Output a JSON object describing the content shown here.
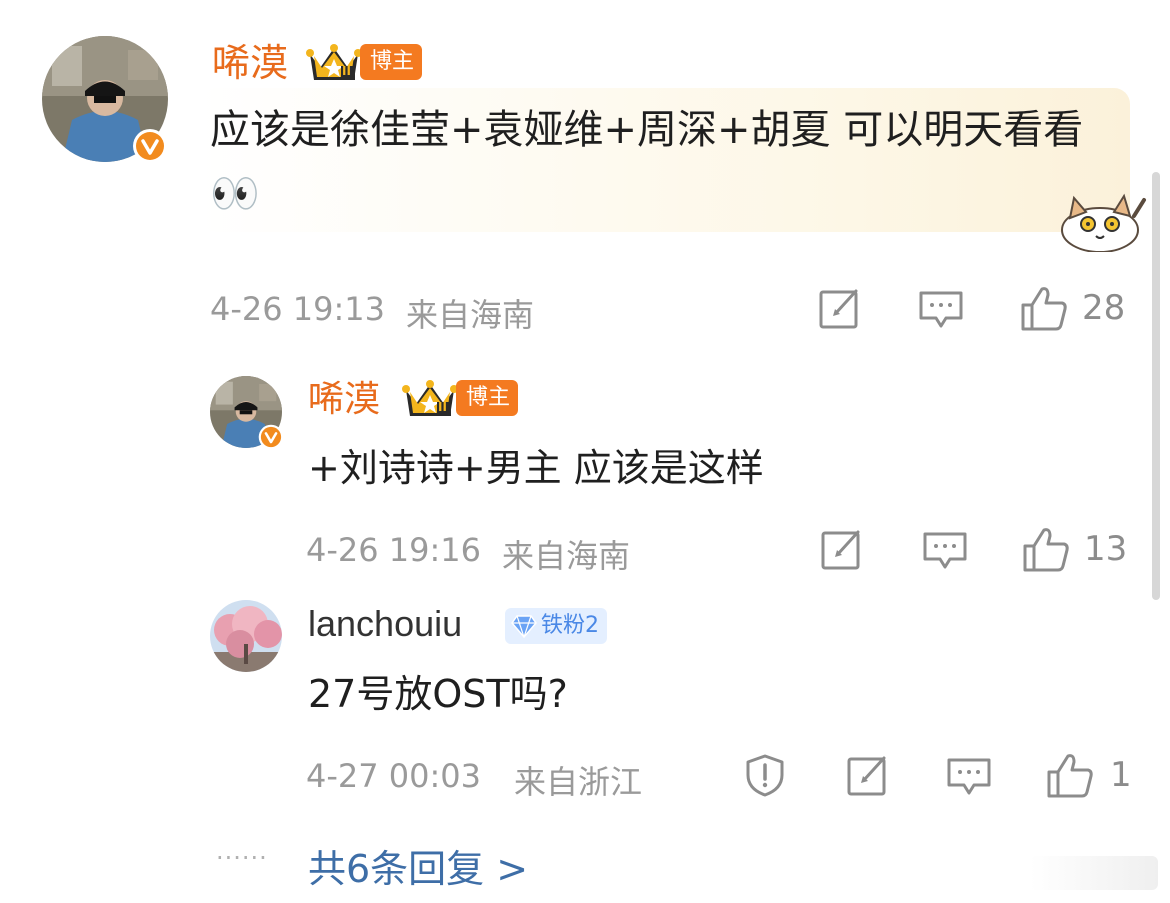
{
  "comments": [
    {
      "username": "唏漠",
      "badge": "博主",
      "level": "II",
      "text": "应该是徐佳莹+袁娅维+周深+胡夏 可以明天看看👀",
      "time": "4-26 19:13",
      "location": "来自海南",
      "likes": "28"
    },
    {
      "username": "唏漠",
      "badge": "博主",
      "level": "II",
      "text": "+刘诗诗+男主 应该是这样",
      "time": "4-26 19:16",
      "location": "来自海南",
      "likes": "13"
    },
    {
      "username": "lanchouiu",
      "badge": "铁粉2",
      "text": "27号放OST吗?",
      "time": "4-27 00:03",
      "location": "来自浙江",
      "likes": "1"
    }
  ],
  "footer": {
    "dots": "······",
    "more_replies": "共6条回复 >"
  },
  "colors": {
    "username": "#e86b1c",
    "badge_bozhu": "#f47a20",
    "badge_tiefen": "#4a88e6",
    "link": "#3e6ea7",
    "meta": "#9a9a9a"
  },
  "icons": [
    "verified-v-icon",
    "crown-icon",
    "edit-icon",
    "comment-icon",
    "like-icon",
    "report-shield-icon",
    "diamond-icon",
    "scrollbar"
  ]
}
